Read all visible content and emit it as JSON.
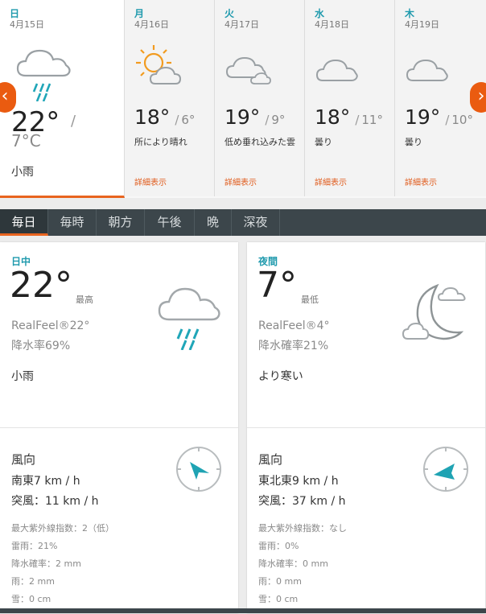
{
  "days": [
    {
      "name": "日",
      "date": "4月15日",
      "hi": "22°",
      "lo": "7°C",
      "condition": "小雨",
      "icon": "rain-cloud-icon",
      "link": ""
    },
    {
      "name": "月",
      "date": "4月16日",
      "hi": "18°",
      "lo": "6°",
      "condition": "所により晴れ",
      "icon": "partly-sunny-icon",
      "link": "詳細表示"
    },
    {
      "name": "火",
      "date": "4月17日",
      "hi": "19°",
      "lo": "9°",
      "condition": "低め垂れ込みた雲",
      "icon": "cloudy-icon",
      "link": "詳細表示"
    },
    {
      "name": "水",
      "date": "4月18日",
      "hi": "18°",
      "lo": "11°",
      "condition": "曇り",
      "icon": "cloud-icon",
      "link": "詳細表示"
    },
    {
      "name": "木",
      "date": "4月19日",
      "hi": "19°",
      "lo": "10°",
      "condition": "曇り",
      "icon": "cloud-icon",
      "link": "詳細表示"
    }
  ],
  "sep": "/",
  "nav": {
    "prev": "‹",
    "next": "›"
  },
  "tabs": [
    "毎日",
    "毎時",
    "朝方",
    "午後",
    "晩",
    "深夜"
  ],
  "day_card": {
    "label": "日中",
    "temp": "22°",
    "hilo": "最高",
    "realfeel": "RealFeel®22°",
    "precip": "降水率69%",
    "phrase": "小雨",
    "wind_label": "風向",
    "wind": "南東7 km / h",
    "gust": "突風：11 km / h",
    "uv": "最大紫外線指数：2（低）",
    "thunder": "雷雨：21%",
    "precip_amount": "降水確率：2 mm",
    "rain": "雨：2 mm",
    "snow": "雪：0 cm"
  },
  "night_card": {
    "label": "夜間",
    "temp": "7°",
    "hilo": "最低",
    "realfeel": "RealFeel®4°",
    "precip": "降水確率21%",
    "phrase": "より寒い",
    "wind_label": "風向",
    "wind": "東北東9 km / h",
    "gust": "突風：37 km / h",
    "uv": "最大紫外線指数：なし",
    "thunder": "雷雨：0%",
    "precip_amount": "降水確率：0 mm",
    "rain": "雨：0 mm",
    "snow": "雪：0 cm"
  },
  "colors": {
    "accent": "#e8641f",
    "teal": "#1f9aad",
    "tabbar": "#3c464b"
  }
}
